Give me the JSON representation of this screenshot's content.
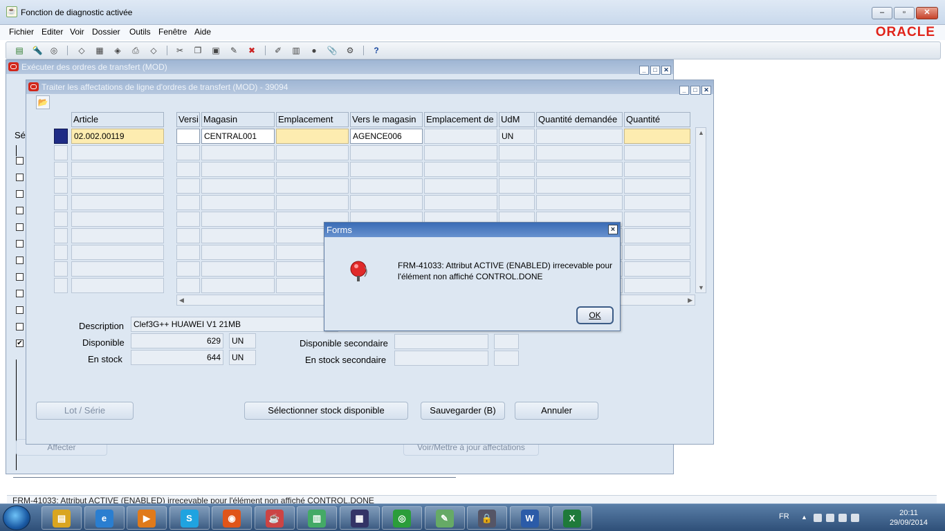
{
  "app": {
    "title": "Fonction de diagnostic activée",
    "brand": "ORACLE",
    "menu": [
      "Fichier",
      "Editer",
      "Voir",
      "Dossier",
      "Outils",
      "Fenêtre",
      "Aide"
    ]
  },
  "win_exec": {
    "title": "Exécuter des ordres de transfert (MOD)",
    "sel_label": "Sé",
    "checkboxes": [
      false,
      false,
      false,
      false,
      false,
      false,
      false,
      false,
      false,
      false,
      false,
      true
    ],
    "affecter_button": "Affecter",
    "voir_button": "Voir/Mettre à jour affectations"
  },
  "win_traiter": {
    "title": "Traiter les affectations de ligne d'ordres de transfert (MOD) - 39094",
    "columns": [
      "Article",
      "Versi",
      "Magasin",
      "Emplacement",
      "Vers le magasin",
      "Emplacement de",
      "UdM",
      "Quantité demandée",
      "Quantité"
    ],
    "rows": [
      {
        "article": "02.002.00119",
        "versi": "",
        "magasin": "CENTRAL001",
        "emplacement": "",
        "vers_magasin": "AGENCE006",
        "emplacement_de": "",
        "udm": "UN",
        "qte_demandee": "",
        "quantite": ""
      }
    ],
    "description_label": "Description",
    "description_value": "Clef3G++ HUAWEI V1 21MB",
    "disponible_label": "Disponible",
    "disponible_value": "629",
    "disponible_unit": "UN",
    "en_stock_label": "En stock",
    "en_stock_value": "644",
    "en_stock_unit": "UN",
    "disp_sec_label": "Disponible secondaire",
    "en_stock_sec_label": "En stock secondaire",
    "buttons": {
      "lot": "Lot / Série",
      "selectionner": "Sélectionner stock disponible",
      "sauvegarder": "Sauvegarder (B)",
      "annuler": "Annuler"
    }
  },
  "dialog": {
    "title": "Forms",
    "message": "FRM-41033: Attribut ACTIVE (ENABLED) irrecevable pour l'élément non affiché CONTROL.DONE",
    "ok": "OK"
  },
  "status_bar": "FRM-41033: Attribut ACTIVE (ENABLED) irrecevable pour l'élément non affiché CONTROL.DONE",
  "taskbar": {
    "apps": [
      "explorer-icon",
      "ie-icon",
      "media-player-icon",
      "skype-icon",
      "firefox-icon",
      "java-icon",
      "database-icon",
      "report-icon",
      "chrome-icon",
      "notepad-icon",
      "vpn-icon",
      "word-icon",
      "excel-icon"
    ],
    "language": "FR",
    "time": "20:11",
    "date": "29/09/2014"
  }
}
